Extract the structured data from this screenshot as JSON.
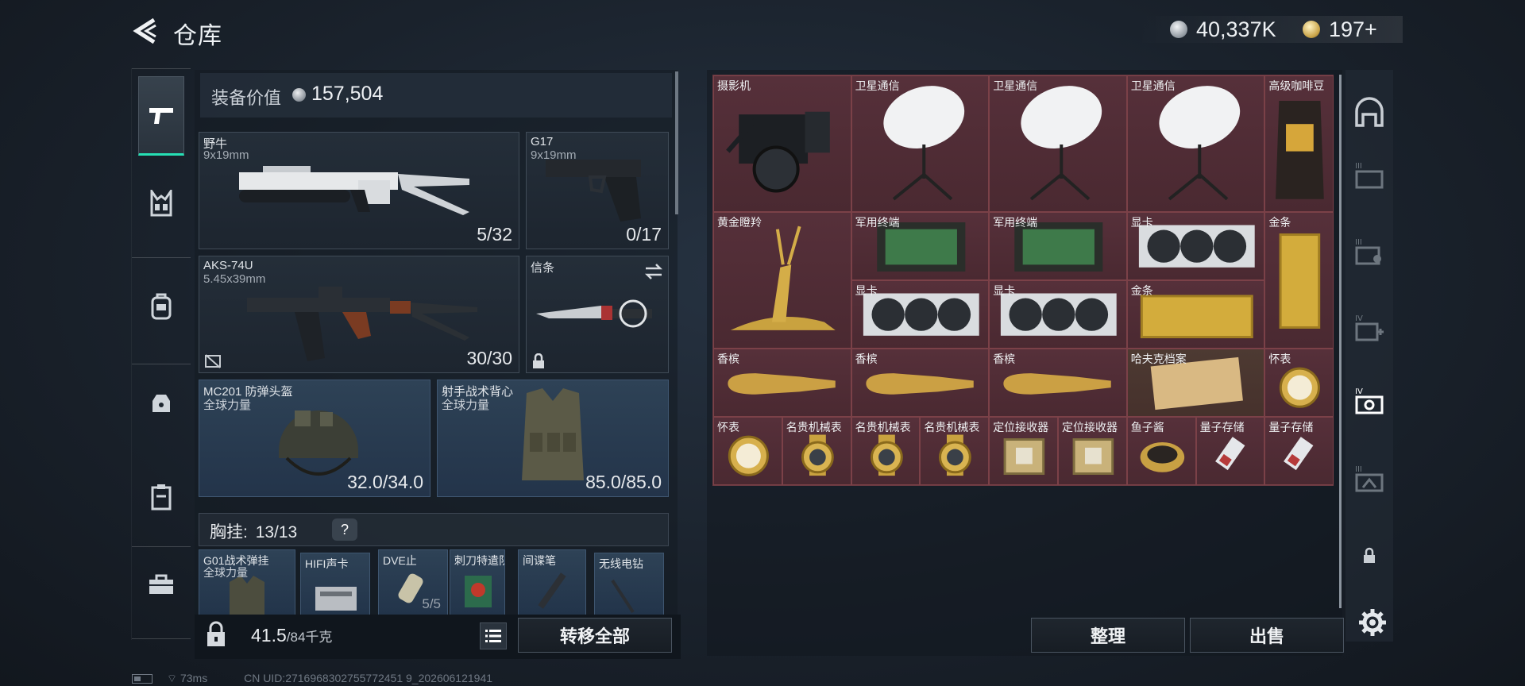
{
  "header": {
    "title": "仓库",
    "silver_amount": "40,337K",
    "gold_amount": "197+"
  },
  "equipment": {
    "value_label": "装备价值",
    "value_amount": "157,504",
    "primary": {
      "name": "野牛",
      "ammo": "9x19mm",
      "count": "5/32"
    },
    "sidearm": {
      "name": "G17",
      "ammo": "9x19mm",
      "count": "0/17"
    },
    "secondary": {
      "name": "AKS-74U",
      "ammo": "5.45x39mm",
      "count": "30/30"
    },
    "melee": {
      "name": "信条"
    },
    "helmet": {
      "name": "MC201 防弹头盔",
      "sub": "全球力量",
      "durability": "32.0/34.0"
    },
    "armor": {
      "name": "射手战术背心",
      "sub": "全球力量",
      "durability": "85.0/85.0"
    },
    "chest_rig": {
      "label": "胸挂:",
      "count": "13/13",
      "help": "?"
    },
    "pockets": [
      {
        "name": "G01战术弹挂",
        "sub": "全球力量"
      },
      {
        "name": "HIFI声卡",
        "sub": ""
      },
      {
        "name": "DVE止",
        "sub": "",
        "count": "5/5"
      },
      {
        "name": "刺刀特遣队",
        "sub": ""
      },
      {
        "name": "间谍笔",
        "sub": ""
      },
      {
        "name": "无线电钻",
        "sub": ""
      }
    ],
    "weight_value": "41.5",
    "weight_max": "/84千克",
    "transfer_all": "转移全部"
  },
  "stash": {
    "items": [
      {
        "name": "摄影机"
      },
      {
        "name": "卫星通信"
      },
      {
        "name": "卫星通信"
      },
      {
        "name": "卫星通信"
      },
      {
        "name": "高级咖啡豆"
      },
      {
        "name": "黄金瞪羚"
      },
      {
        "name": "军用终端"
      },
      {
        "name": "军用终端"
      },
      {
        "name": "显卡"
      },
      {
        "name": "金条"
      },
      {
        "name": "显卡"
      },
      {
        "name": "显卡"
      },
      {
        "name": "金条"
      },
      {
        "name": "香槟"
      },
      {
        "name": "香槟"
      },
      {
        "name": "香槟"
      },
      {
        "name": "哈夫克档案"
      },
      {
        "name": "怀表"
      },
      {
        "name": "怀表"
      },
      {
        "name": "名贵机械表"
      },
      {
        "name": "名贵机械表"
      },
      {
        "name": "名贵机械表"
      },
      {
        "name": "定位接收器"
      },
      {
        "name": "定位接收器"
      },
      {
        "name": "鱼子酱"
      },
      {
        "name": "量子存储"
      },
      {
        "name": "量子存储"
      }
    ],
    "sort_button": "整理",
    "sell_button": "出售"
  },
  "status": {
    "ping": "73ms",
    "uid": "CN UID:2716968302755772451 9_202606121941"
  },
  "colors": {
    "accent": "#26e0b4",
    "stash_cell": "#4a2931",
    "equip_slot": "#23344a"
  }
}
